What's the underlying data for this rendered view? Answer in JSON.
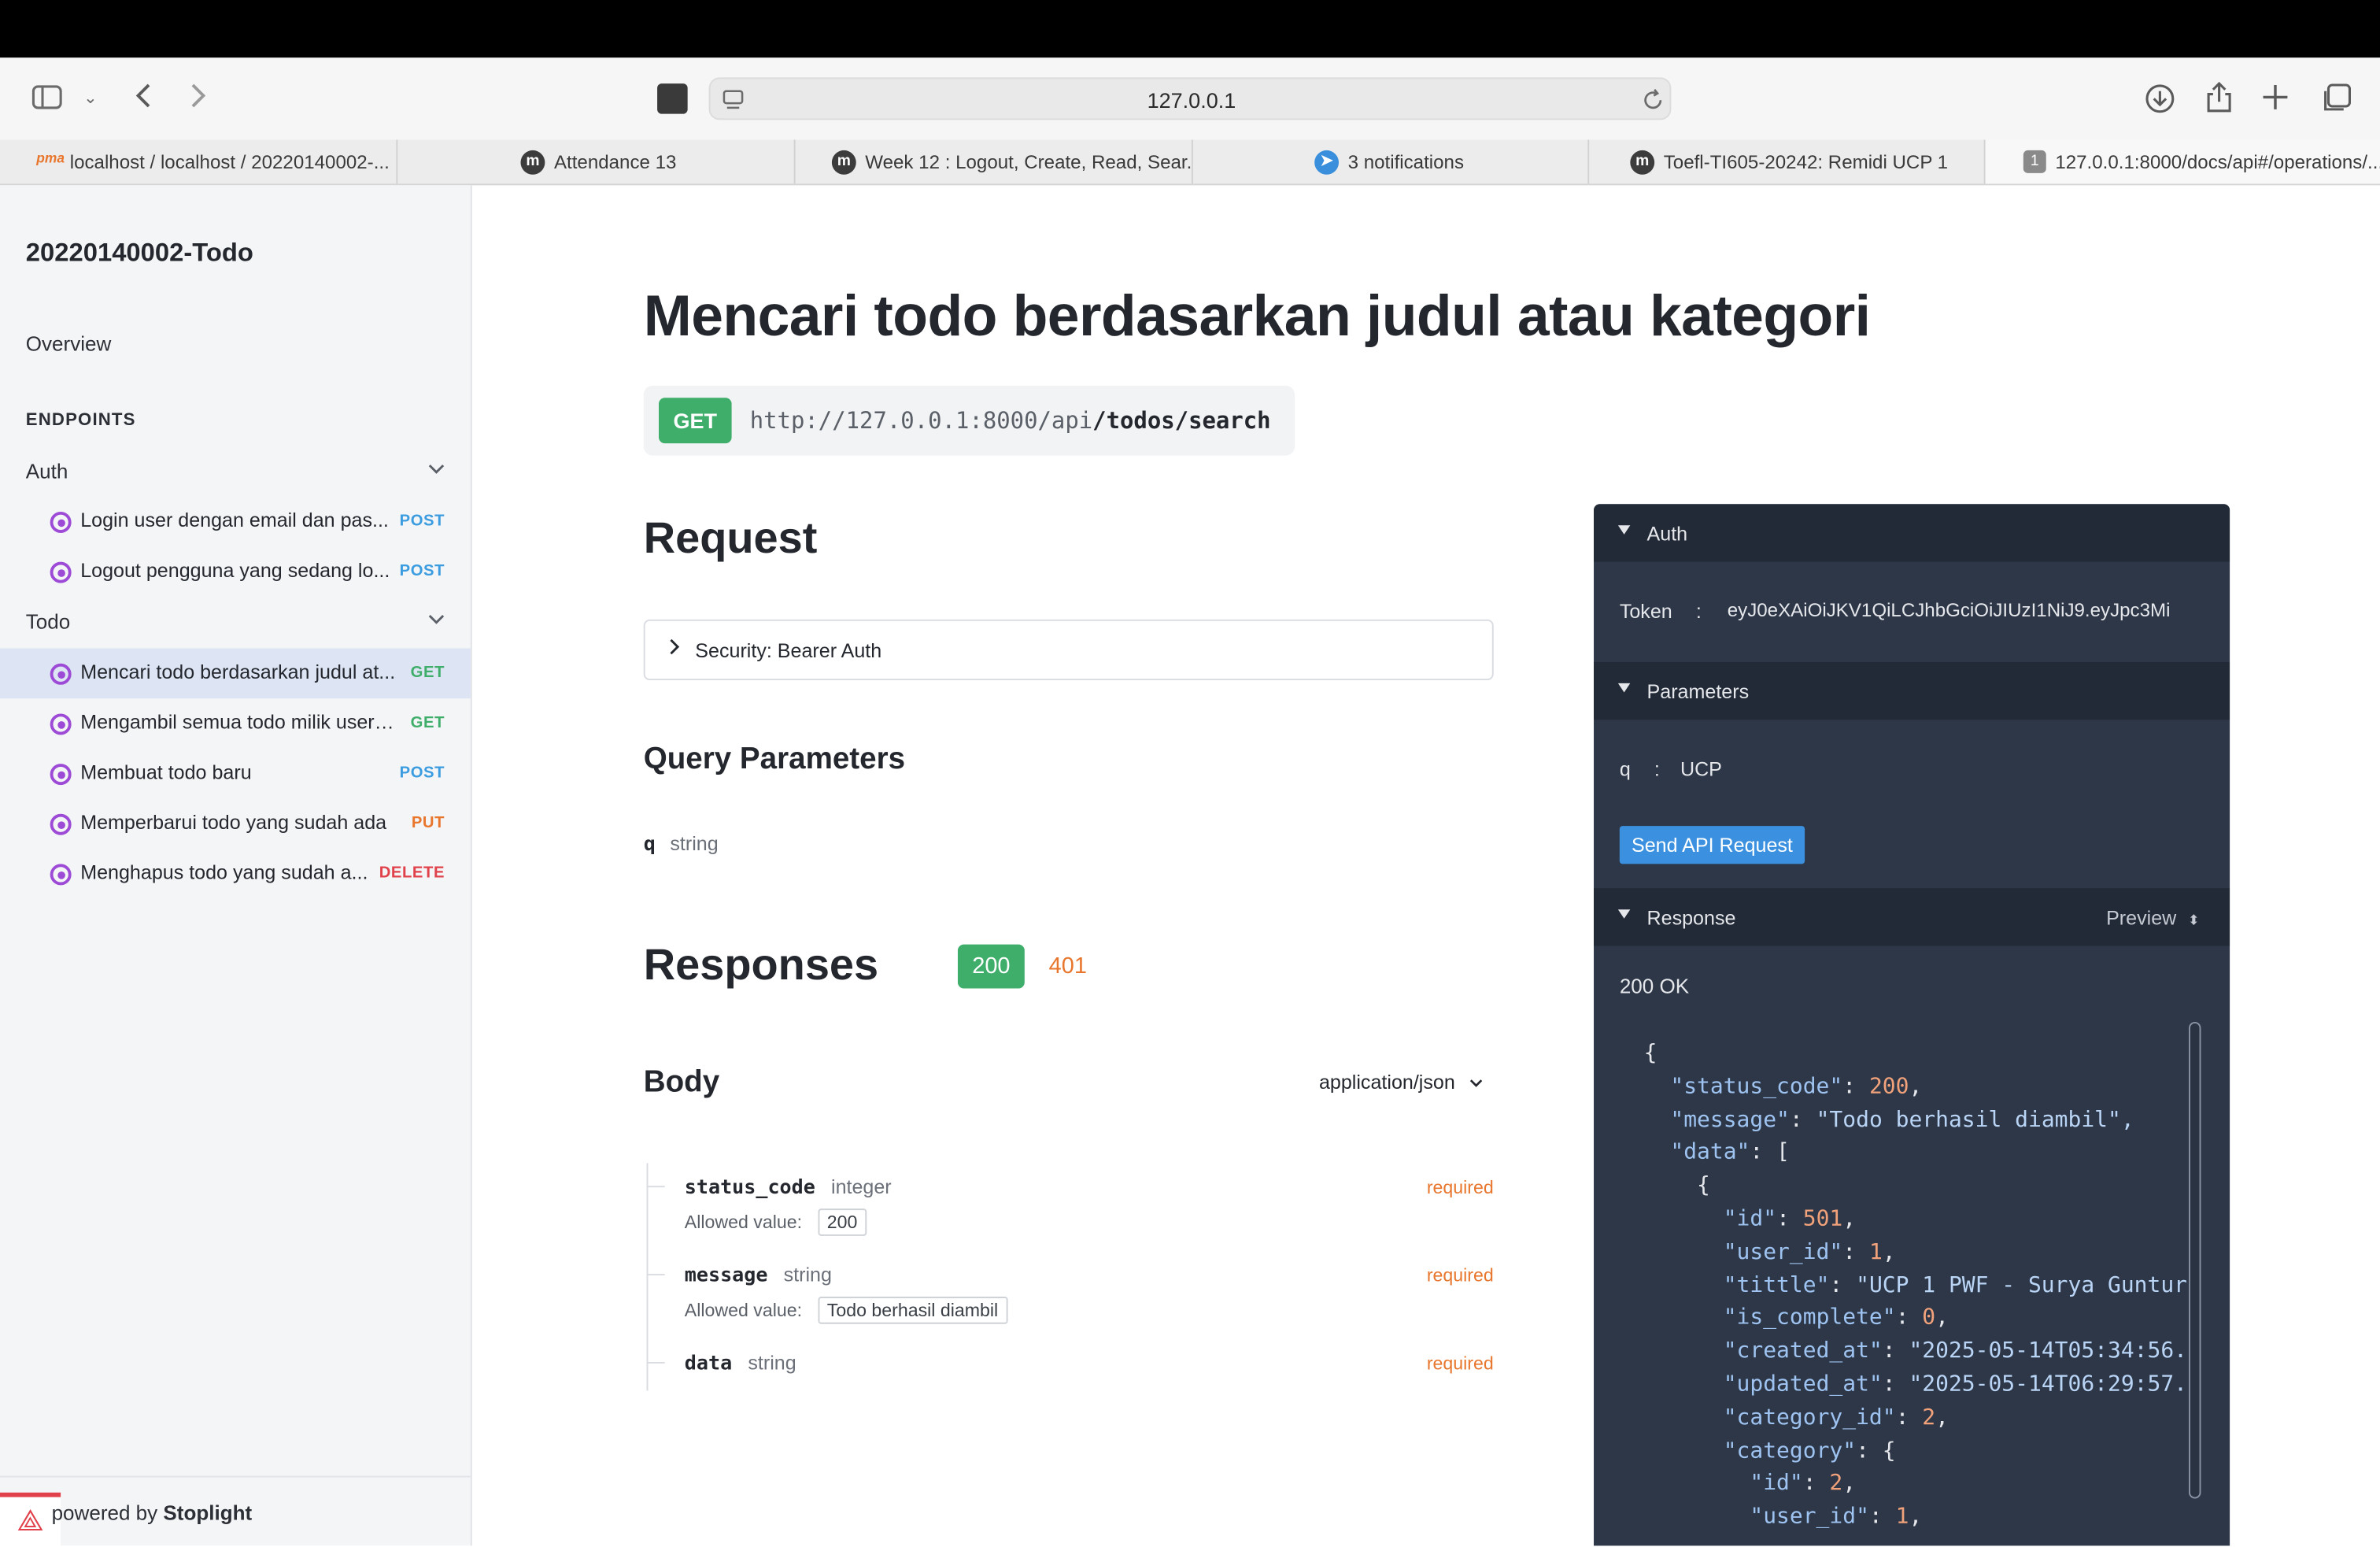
{
  "browser": {
    "url": "127.0.0.1",
    "tabs": [
      {
        "label": "localhost / localhost / 20220140002-...",
        "icon": "phpmyadmin-icon"
      },
      {
        "label": "Attendance 13",
        "icon": "moodle-icon"
      },
      {
        "label": "Week 12 : Logout, Create, Read, Sear...",
        "icon": "moodle-icon"
      },
      {
        "label": "3 notifications",
        "icon": "telegram-icon"
      },
      {
        "label": "Toefl-TI605-20242: Remidi UCP 1",
        "icon": "moodle-icon"
      },
      {
        "label": "127.0.0.1:8000/docs/api#/operations/...",
        "icon": "number-one-icon",
        "badge": "1"
      }
    ]
  },
  "sidebar": {
    "title": "20220140002-Todo",
    "overview": "Overview",
    "endpoints_label": "ENDPOINTS",
    "groups": [
      {
        "label": "Auth",
        "items": [
          {
            "label": "Login user dengan email dan pas...",
            "method": "POST"
          },
          {
            "label": "Logout pengguna yang sedang lo...",
            "method": "POST"
          }
        ]
      },
      {
        "label": "Todo",
        "items": [
          {
            "label": "Mencari todo berdasarkan judul at...",
            "method": "GET",
            "active": true
          },
          {
            "label": "Mengambil semua todo milik user ...",
            "method": "GET"
          },
          {
            "label": "Membuat todo baru",
            "method": "POST"
          },
          {
            "label": "Memperbarui todo yang sudah ada",
            "method": "PUT"
          },
          {
            "label": "Menghapus todo yang sudah a...",
            "method": "DELETE"
          }
        ]
      }
    ],
    "footer_prefix": "powered by ",
    "footer_brand": "Stoplight"
  },
  "main": {
    "title": "Mencari todo berdasarkan judul atau kategori",
    "method": "GET",
    "url_base": "http://127.0.0.1:8000/api",
    "url_path": "/todos/search",
    "request_heading": "Request",
    "security_label": "Security: Bearer Auth",
    "query_heading": "Query Parameters",
    "query_param": {
      "name": "q",
      "type": "string"
    },
    "responses_heading": "Responses",
    "response_codes": [
      "200",
      "401"
    ],
    "body_heading": "Body",
    "content_type": "application/json",
    "fields": [
      {
        "name": "status_code",
        "type": "integer",
        "required": "required",
        "allowed_label": "Allowed value:",
        "allowed": "200"
      },
      {
        "name": "message",
        "type": "string",
        "required": "required",
        "allowed_label": "Allowed value:",
        "allowed": "Todo berhasil diambil"
      },
      {
        "name": "data",
        "type": "string",
        "required": "required"
      }
    ]
  },
  "panel": {
    "auth_heading": "Auth",
    "token_label": "Token",
    "token_sep": ":",
    "token_value": "eyJ0eXAiOiJKV1QiLCJhbGciOiJIUzI1NiJ9.eyJpc3Mi",
    "params_heading": "Parameters",
    "param_name": "q",
    "param_sep": ":",
    "param_value": "UCP",
    "send_button": "Send API Request",
    "response_heading": "Response",
    "preview_label": "Preview",
    "status": "200 OK",
    "json_lines": [
      "{",
      "  \"status_code\": 200,",
      "  \"message\": \"Todo berhasil diambil\",",
      "  \"data\": [",
      "    {",
      "      \"id\": 501,",
      "      \"user_id\": 1,",
      "      \"tittle\": \"UCP 1 PWF - Surya Guntur",
      "      \"is_complete\": 0,",
      "      \"created_at\": \"2025-05-14T05:34:56.",
      "      \"updated_at\": \"2025-05-14T06:29:57.",
      "      \"category_id\": 2,",
      "      \"category\": {",
      "        \"id\": 2,",
      "        \"user_id\": 1,"
    ]
  },
  "colors": {
    "get": "#3fae6a",
    "post": "#3b9de0",
    "put": "#e8762d",
    "delete": "#e0414a",
    "panel_bg": "#2d3748",
    "send_button": "#3b91e0"
  }
}
